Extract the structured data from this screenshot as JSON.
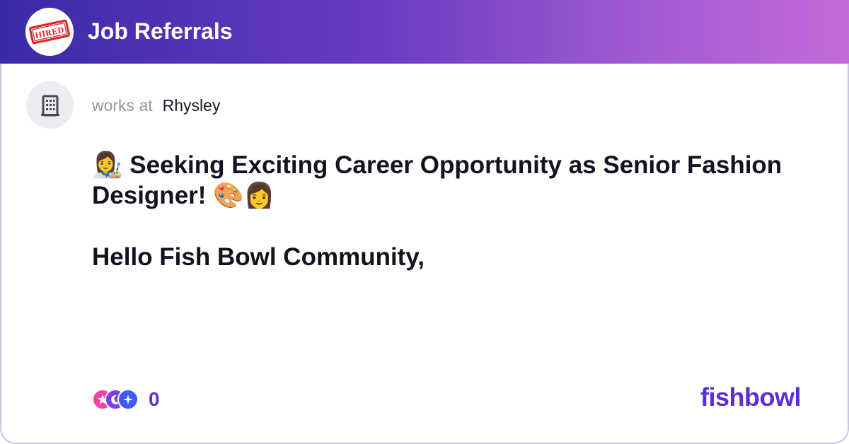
{
  "header": {
    "title": "Job Referrals",
    "logo_text": "HIRED",
    "logo_icon": "hired-stamp-icon",
    "gradient": [
      "#3a2aa8",
      "#c46ad8"
    ]
  },
  "post": {
    "avatar_icon": "building-icon",
    "works_at_label": "works at",
    "company": "Rhysley",
    "title": "👩‍🎨 Seeking Exciting Career Opportunity as Senior Fashion Designer! 🎨👩",
    "body": "Hello Fish Bowl Community,"
  },
  "footer": {
    "reaction_count": "0",
    "reaction_icons": [
      "star-reaction-icon",
      "moon-reaction-icon",
      "sparkle-reaction-icon"
    ],
    "brand": "fishbowl"
  },
  "colors": {
    "accent": "#5a2fd6",
    "muted_text": "#9a95a8",
    "border": "#c9c6e0"
  }
}
